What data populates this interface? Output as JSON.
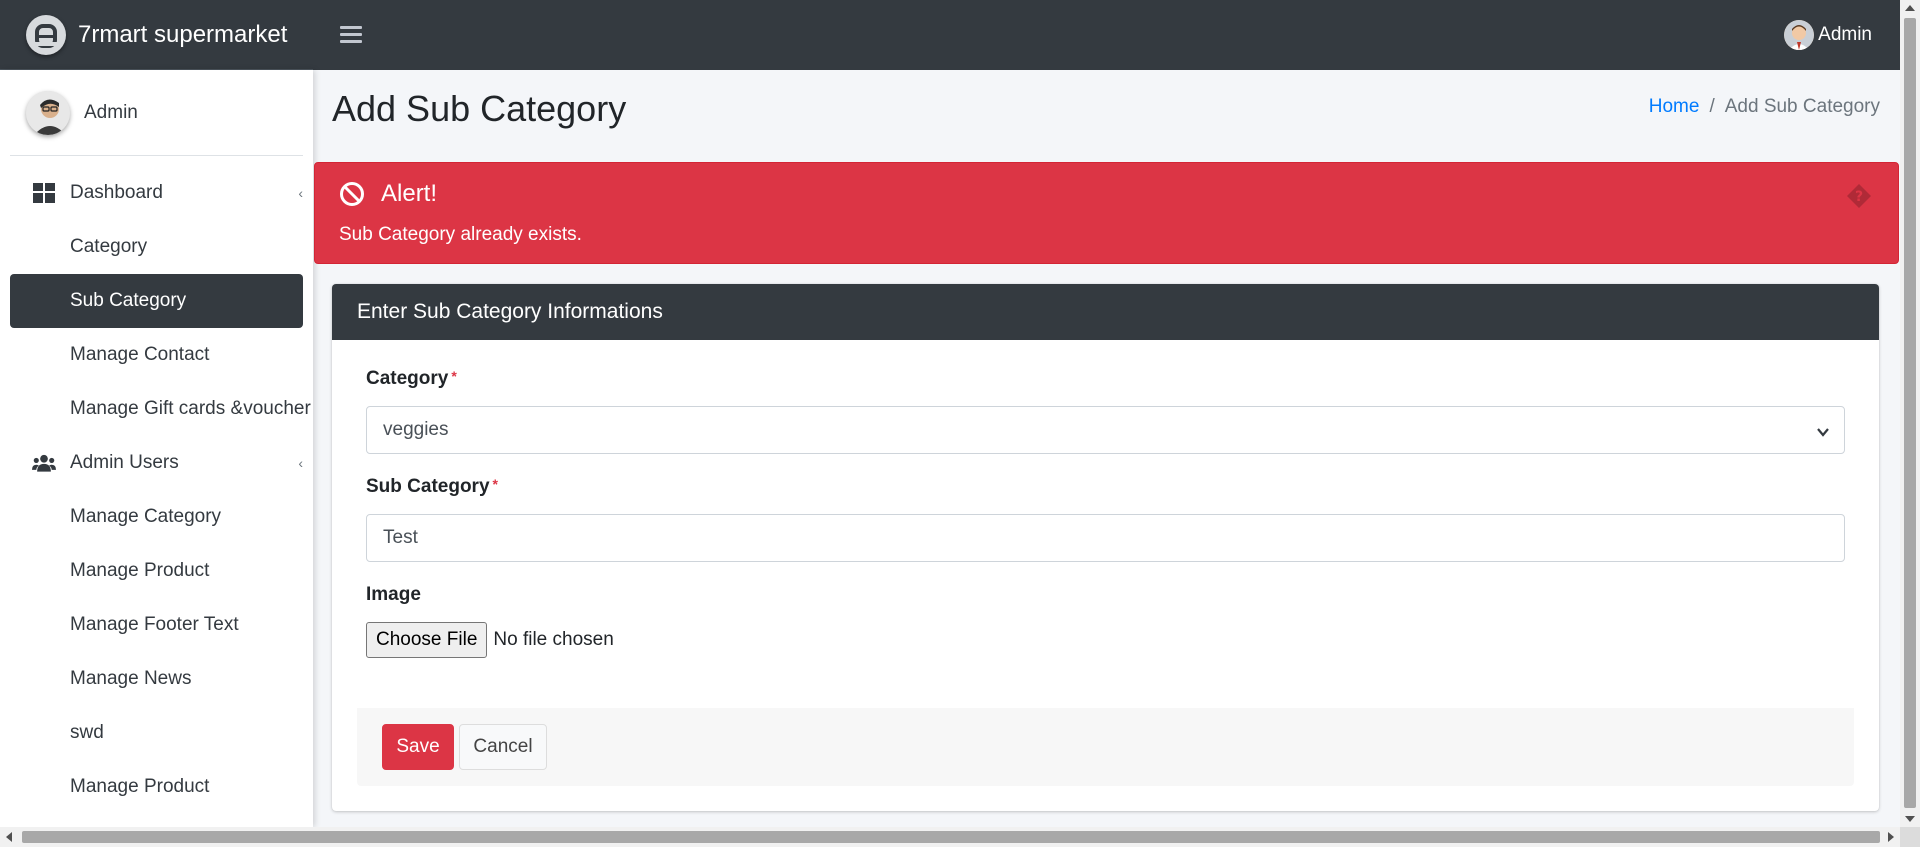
{
  "app": {
    "brand_name": "7rmart supermarket",
    "top_user_name": "Admin"
  },
  "sidebar": {
    "user_name": "Admin",
    "items": [
      {
        "label": "Dashboard",
        "icon": "dashboard-icon",
        "has_caret": true,
        "active": false,
        "indent": false
      },
      {
        "label": "Category",
        "active": false,
        "indent": true
      },
      {
        "label": "Sub Category",
        "active": true,
        "indent": true
      },
      {
        "label": "Manage Contact",
        "active": false,
        "indent": true
      },
      {
        "label": "Manage Gift cards &voucher",
        "active": false,
        "indent": true
      },
      {
        "label": "Admin Users",
        "icon": "users-icon",
        "has_caret": true,
        "active": false,
        "indent": false
      },
      {
        "label": "Manage Category",
        "active": false,
        "indent": true
      },
      {
        "label": "Manage Product",
        "active": false,
        "indent": true
      },
      {
        "label": "Manage Footer Text",
        "active": false,
        "indent": true
      },
      {
        "label": "Manage News",
        "active": false,
        "indent": true
      },
      {
        "label": "swd",
        "active": false,
        "indent": true
      },
      {
        "label": "Manage Product",
        "active": false,
        "indent": true
      }
    ]
  },
  "page": {
    "title": "Add Sub Category",
    "breadcrumb": {
      "home": "Home",
      "separator": "/",
      "current": "Add Sub Category"
    }
  },
  "alert": {
    "title": "Alert!",
    "message": "Sub Category already exists.",
    "color": "#dc3545"
  },
  "form": {
    "header": "Enter Sub Category Informations",
    "category_label": "Category",
    "category_required_mark": "*",
    "category_value": "veggies",
    "subcategory_label": "Sub Category",
    "subcategory_required_mark": "*",
    "subcategory_value": "Test",
    "image_label": "Image",
    "file_button": "Choose File",
    "file_status": "No file chosen",
    "save_label": "Save",
    "cancel_label": "Cancel"
  },
  "colors": {
    "navbar": "#343a40",
    "accent_danger": "#dc3545",
    "link": "#007bff"
  }
}
